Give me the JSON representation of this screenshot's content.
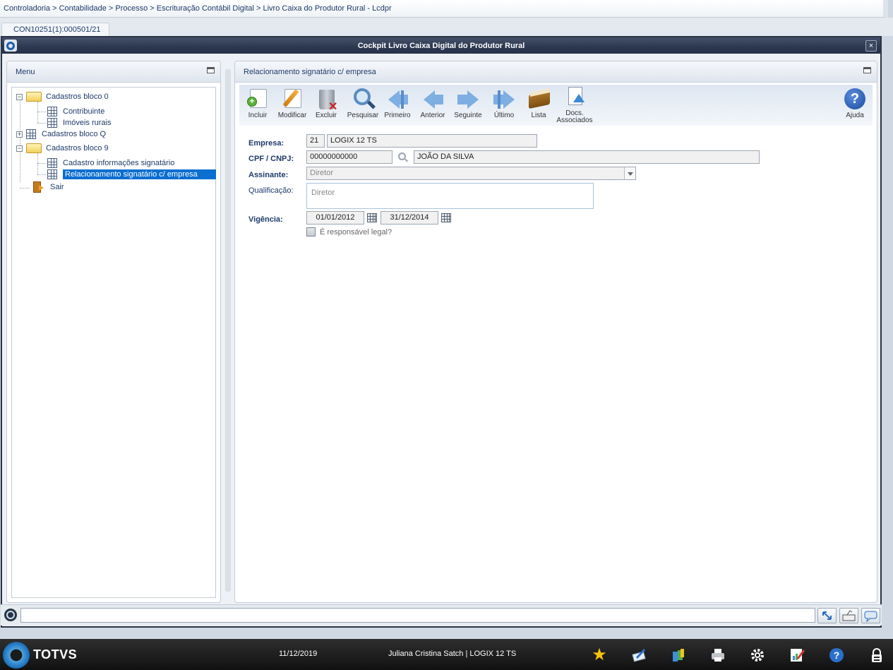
{
  "breadcrumb": "Controladoria > Contabilidade > Processo > Escrituração Contábil Digital > Livro Caixa do Produtor Rural - Lcdpr",
  "tab": {
    "label": "CON10251(1):000501/21"
  },
  "window": {
    "title": "Cockpit Livro Caixa Digital do Produtor Rural",
    "close_label": "×"
  },
  "menu": {
    "title": "Menu",
    "tree": [
      {
        "label": "Cadastros bloco 0",
        "expander": "−"
      },
      {
        "label": "Contribuinte"
      },
      {
        "label": "Imóveis rurais"
      },
      {
        "label": "Cadastros bloco Q",
        "expander": "+"
      },
      {
        "label": "Cadastros bloco 9",
        "expander": "−"
      },
      {
        "label": "Cadastro informações signatário"
      },
      {
        "label": "Relacionamento signatário c/ empresa",
        "selected": true
      },
      {
        "label": "Sair"
      }
    ]
  },
  "content": {
    "title": "Relacionamento signatário c/ empresa",
    "toolbar": [
      {
        "label": "Incluir",
        "icon": "add-document-icon"
      },
      {
        "label": "Modificar",
        "icon": "edit-pencil-icon"
      },
      {
        "label": "Excluir",
        "icon": "trash-icon"
      },
      {
        "label": "Pesquisar",
        "icon": "magnifier-icon"
      },
      {
        "label": "Primeiro",
        "icon": "first-arrow-icon"
      },
      {
        "label": "Anterior",
        "icon": "prev-arrow-icon"
      },
      {
        "label": "Seguinte",
        "icon": "next-arrow-icon"
      },
      {
        "label": "Último",
        "icon": "last-arrow-icon"
      },
      {
        "label": "Lista",
        "icon": "book-icon"
      },
      {
        "label_line1": "Docs.",
        "label_line2": "Associados",
        "icon": "upload-doc-icon"
      },
      {
        "label": "Ajuda",
        "icon": "help-icon"
      }
    ],
    "form": {
      "empresa_label": "Empresa:",
      "empresa_code": "21",
      "empresa_name": "LOGIX 12 TS",
      "cpf_label": "CPF / CNPJ:",
      "cpf_value": "00000000000",
      "cpf_name": "JOÃO DA SILVA",
      "assinante_label": "Assinante:",
      "assinante_value": "Diretor",
      "qualificacao_label": "Qualificação:",
      "qualificacao_value": "Diretor",
      "vigencia_label": "Vigência:",
      "vigencia_start": "01/01/2012",
      "vigencia_end": "31/12/2014",
      "responsavel_label": "É responsável legal?"
    }
  },
  "taskbar": {
    "brand": "TOTVS",
    "date": "11/12/2019",
    "user": "Juliana Cristina Satch | LOGIX 12 TS"
  },
  "colors": {
    "titlebar": "#2c3850",
    "selection": "#0b6ed0",
    "taskbar": "#111111"
  }
}
